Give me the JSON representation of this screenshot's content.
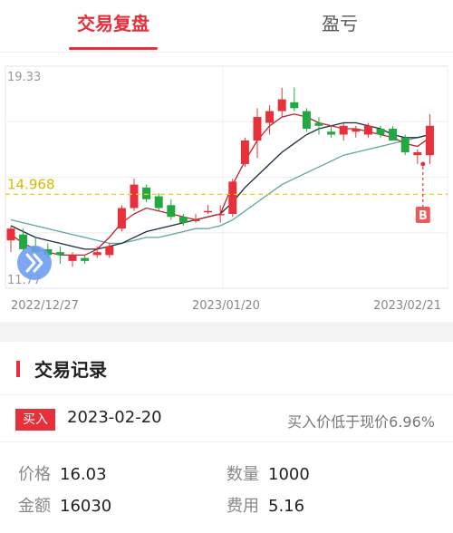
{
  "tabs": [
    {
      "label": "交易复盘",
      "active": true
    },
    {
      "label": "盈亏",
      "active": false
    }
  ],
  "chart": {
    "y_max_label": "19.33",
    "y_min_label": "11.77",
    "ref_price_label": "14.968",
    "date_labels": [
      "2022/12/27",
      "2023/01/20",
      "2023/02/21"
    ],
    "buy_marker": "B",
    "colors": {
      "up": "#e8303a",
      "down": "#22a841",
      "ma5": "#c0202a",
      "ma10": "#1d2b3a",
      "ma20": "#5fa5a0",
      "ref": "#e8d100"
    }
  },
  "chart_data": {
    "type": "candlestick",
    "ylim": [
      11.77,
      19.33
    ],
    "reference_price": 14.968,
    "candles": [
      {
        "o": 13.4,
        "h": 13.9,
        "l": 13.0,
        "c": 13.8
      },
      {
        "o": 13.6,
        "h": 13.8,
        "l": 13.0,
        "c": 13.1
      },
      {
        "o": 13.2,
        "h": 13.5,
        "l": 12.9,
        "c": 13.0
      },
      {
        "o": 13.1,
        "h": 13.3,
        "l": 12.8,
        "c": 12.9
      },
      {
        "o": 13.0,
        "h": 13.2,
        "l": 12.6,
        "c": 12.9
      },
      {
        "o": 12.7,
        "h": 13.0,
        "l": 12.5,
        "c": 12.9
      },
      {
        "o": 12.8,
        "h": 12.9,
        "l": 12.6,
        "c": 12.7
      },
      {
        "o": 12.9,
        "h": 13.2,
        "l": 12.8,
        "c": 13.0
      },
      {
        "o": 12.9,
        "h": 13.3,
        "l": 12.8,
        "c": 13.2
      },
      {
        "o": 13.8,
        "h": 14.6,
        "l": 13.7,
        "c": 14.5
      },
      {
        "o": 14.5,
        "h": 15.5,
        "l": 14.4,
        "c": 15.3
      },
      {
        "o": 15.2,
        "h": 15.3,
        "l": 14.7,
        "c": 14.8
      },
      {
        "o": 14.9,
        "h": 15.0,
        "l": 14.4,
        "c": 14.5
      },
      {
        "o": 14.6,
        "h": 14.8,
        "l": 14.1,
        "c": 14.2
      },
      {
        "o": 14.2,
        "h": 14.3,
        "l": 13.9,
        "c": 14.0
      },
      {
        "o": 14.1,
        "h": 14.3,
        "l": 14.0,
        "c": 14.1
      },
      {
        "o": 14.4,
        "h": 14.6,
        "l": 14.3,
        "c": 14.4
      },
      {
        "o": 14.3,
        "h": 14.6,
        "l": 14.0,
        "c": 14.3
      },
      {
        "o": 14.3,
        "h": 15.5,
        "l": 14.2,
        "c": 15.4
      },
      {
        "o": 16.0,
        "h": 16.9,
        "l": 15.9,
        "c": 16.8
      },
      {
        "o": 16.8,
        "h": 17.9,
        "l": 16.2,
        "c": 17.6
      },
      {
        "o": 17.4,
        "h": 18.0,
        "l": 17.0,
        "c": 17.8
      },
      {
        "o": 17.8,
        "h": 18.6,
        "l": 17.6,
        "c": 18.2
      },
      {
        "o": 18.1,
        "h": 18.6,
        "l": 17.8,
        "c": 17.9
      },
      {
        "o": 17.8,
        "h": 17.9,
        "l": 17.1,
        "c": 17.2
      },
      {
        "o": 17.4,
        "h": 17.6,
        "l": 17.0,
        "c": 17.3
      },
      {
        "o": 17.1,
        "h": 17.3,
        "l": 16.9,
        "c": 17.0
      },
      {
        "o": 17.0,
        "h": 17.4,
        "l": 16.8,
        "c": 17.3
      },
      {
        "o": 17.1,
        "h": 17.3,
        "l": 16.9,
        "c": 17.2
      },
      {
        "o": 17.0,
        "h": 17.4,
        "l": 16.9,
        "c": 17.3
      },
      {
        "o": 17.2,
        "h": 17.3,
        "l": 16.9,
        "c": 17.0
      },
      {
        "o": 17.2,
        "h": 17.3,
        "l": 16.8,
        "c": 16.8
      },
      {
        "o": 16.9,
        "h": 17.0,
        "l": 16.3,
        "c": 16.4
      },
      {
        "o": 16.3,
        "h": 16.5,
        "l": 16.0,
        "c": 16.4
      },
      {
        "o": 16.3,
        "h": 17.7,
        "l": 16.0,
        "c": 17.3
      }
    ],
    "ma5": [
      13.6,
      13.3,
      13.1,
      13.0,
      12.9,
      12.9,
      12.9,
      13.1,
      13.5,
      14.0,
      14.3,
      14.5,
      14.4,
      14.3,
      14.2,
      14.1,
      14.2,
      14.3,
      15.3,
      16.1,
      16.8,
      17.3,
      17.6,
      17.7,
      17.6,
      17.4,
      17.3,
      17.2,
      17.2,
      17.1,
      17.0,
      16.9,
      16.7,
      16.6,
      16.9
    ],
    "ma10": [
      13.9,
      13.7,
      13.5,
      13.4,
      13.3,
      13.2,
      13.1,
      13.1,
      13.2,
      13.3,
      13.5,
      13.7,
      13.8,
      13.9,
      14.0,
      14.1,
      14.2,
      14.3,
      14.7,
      15.2,
      15.6,
      16.0,
      16.4,
      16.7,
      17.0,
      17.2,
      17.3,
      17.4,
      17.4,
      17.3,
      17.2,
      17.0,
      16.9,
      16.9,
      17.0
    ],
    "ma20": [
      14.1,
      14.0,
      13.9,
      13.8,
      13.7,
      13.6,
      13.5,
      13.4,
      13.3,
      13.3,
      13.4,
      13.5,
      13.5,
      13.6,
      13.7,
      13.8,
      13.8,
      13.9,
      14.1,
      14.4,
      14.7,
      15.0,
      15.3,
      15.5,
      15.7,
      15.9,
      16.1,
      16.3,
      16.4,
      16.5,
      16.6,
      16.7,
      16.8,
      16.9,
      17.0
    ]
  },
  "section": {
    "title": "交易记录"
  },
  "trade": {
    "type": "买入",
    "date": "2023-02-20",
    "note": "买入价低于现价6.96%",
    "price_label": "价格",
    "price": "16.03",
    "qty_label": "数量",
    "qty": "1000",
    "amount_label": "金额",
    "amount": "16030",
    "fee_label": "费用",
    "fee": "5.16"
  }
}
